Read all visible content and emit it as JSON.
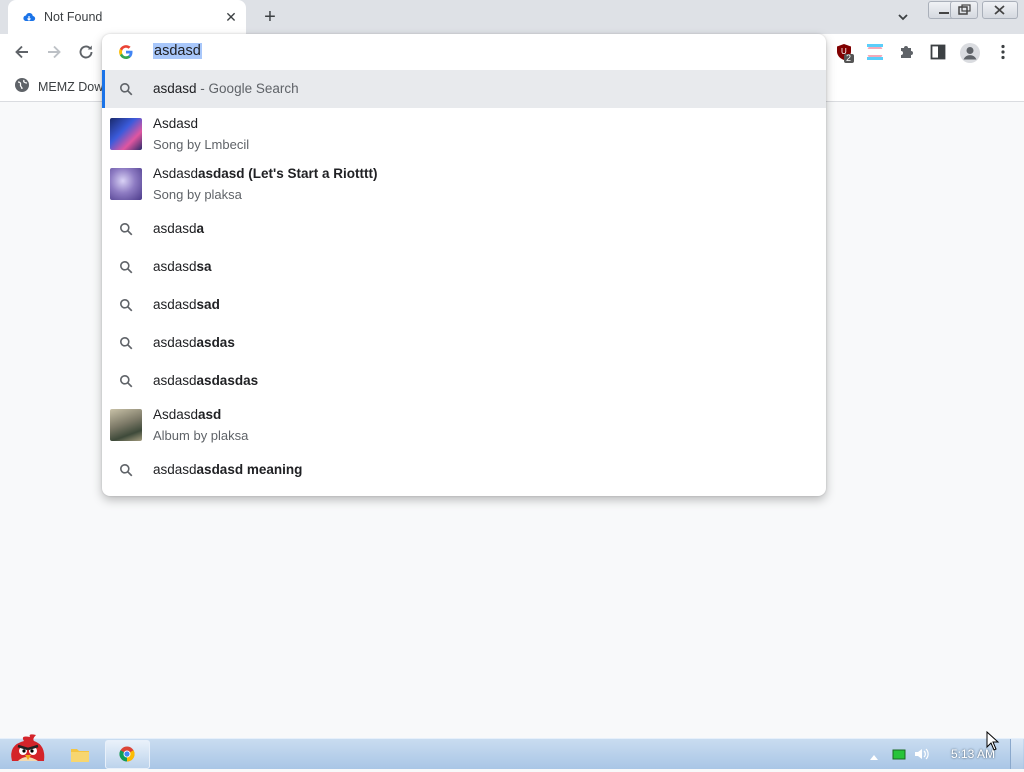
{
  "browser": {
    "tab_title": "Not Found",
    "new_tab_symbol": "+",
    "close_symbol": "✕"
  },
  "omnibox": {
    "input_value": "asdasd",
    "suggestions": [
      {
        "kind": "search",
        "pre": "asdasd",
        "bold": "",
        "sep": " - ",
        "tail": "Google Search"
      },
      {
        "kind": "entity",
        "pre": "Asdasd",
        "bold": "",
        "sub": "Song by Lmbecil"
      },
      {
        "kind": "entity",
        "pre": "Asdasd",
        "bold": "asdasd (Let's Start a Riotttt)",
        "sub": "Song by plaksa"
      },
      {
        "kind": "search",
        "pre": "asdasd",
        "bold": "a"
      },
      {
        "kind": "search",
        "pre": "asdasd",
        "bold": "sa"
      },
      {
        "kind": "search",
        "pre": "asdasd",
        "bold": "sad"
      },
      {
        "kind": "search",
        "pre": "asdasd",
        "bold": "asdas"
      },
      {
        "kind": "search",
        "pre": "asdasd",
        "bold": "asdasdas"
      },
      {
        "kind": "entity",
        "pre": "Asdasd",
        "bold": "asd",
        "sub": "Album by plaksa"
      },
      {
        "kind": "search",
        "pre": "asdasd",
        "bold": "asdasd meaning"
      }
    ]
  },
  "bookmarks": {
    "item1": "MEMZ Down"
  },
  "extensions": {
    "badge_count": "2"
  },
  "taskbar": {
    "time": "5:13 AM"
  },
  "colors": {
    "accent": "#1a73e8",
    "highlight": "#a8c7fa"
  }
}
